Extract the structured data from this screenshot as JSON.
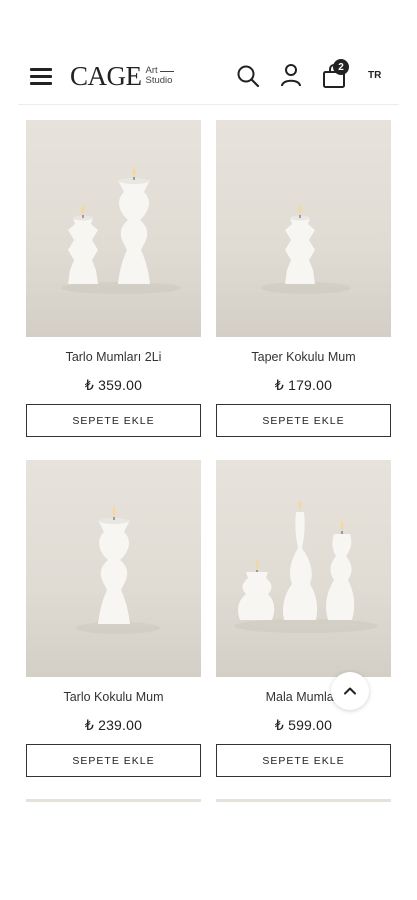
{
  "header": {
    "logo_main": "CAGE",
    "logo_sub_1": "Art",
    "logo_sub_2": "Studio",
    "cart_count": "2",
    "language": "TR"
  },
  "products": [
    {
      "name": "Tarlo Mumları 2Li",
      "price": "₺ 359.00",
      "button": "SEPETE EKLE"
    },
    {
      "name": "Taper Kokulu Mum",
      "price": "₺ 179.00",
      "button": "SEPETE EKLE"
    },
    {
      "name": "Tarlo Kokulu Mum",
      "price": "₺ 239.00",
      "button": "SEPETE EKLE"
    },
    {
      "name": "Mala Mumları",
      "price": "₺ 599.00",
      "button": "SEPETE EKLE"
    }
  ],
  "icons": {
    "menu": "hamburger-menu-icon",
    "search": "search-icon",
    "account": "user-icon",
    "cart": "shopping-bag-icon",
    "scroll_top": "chevron-up-icon"
  },
  "colors": {
    "text": "#222222",
    "image_bg": "#e4e0d9",
    "candle": "#f7f6f2"
  }
}
